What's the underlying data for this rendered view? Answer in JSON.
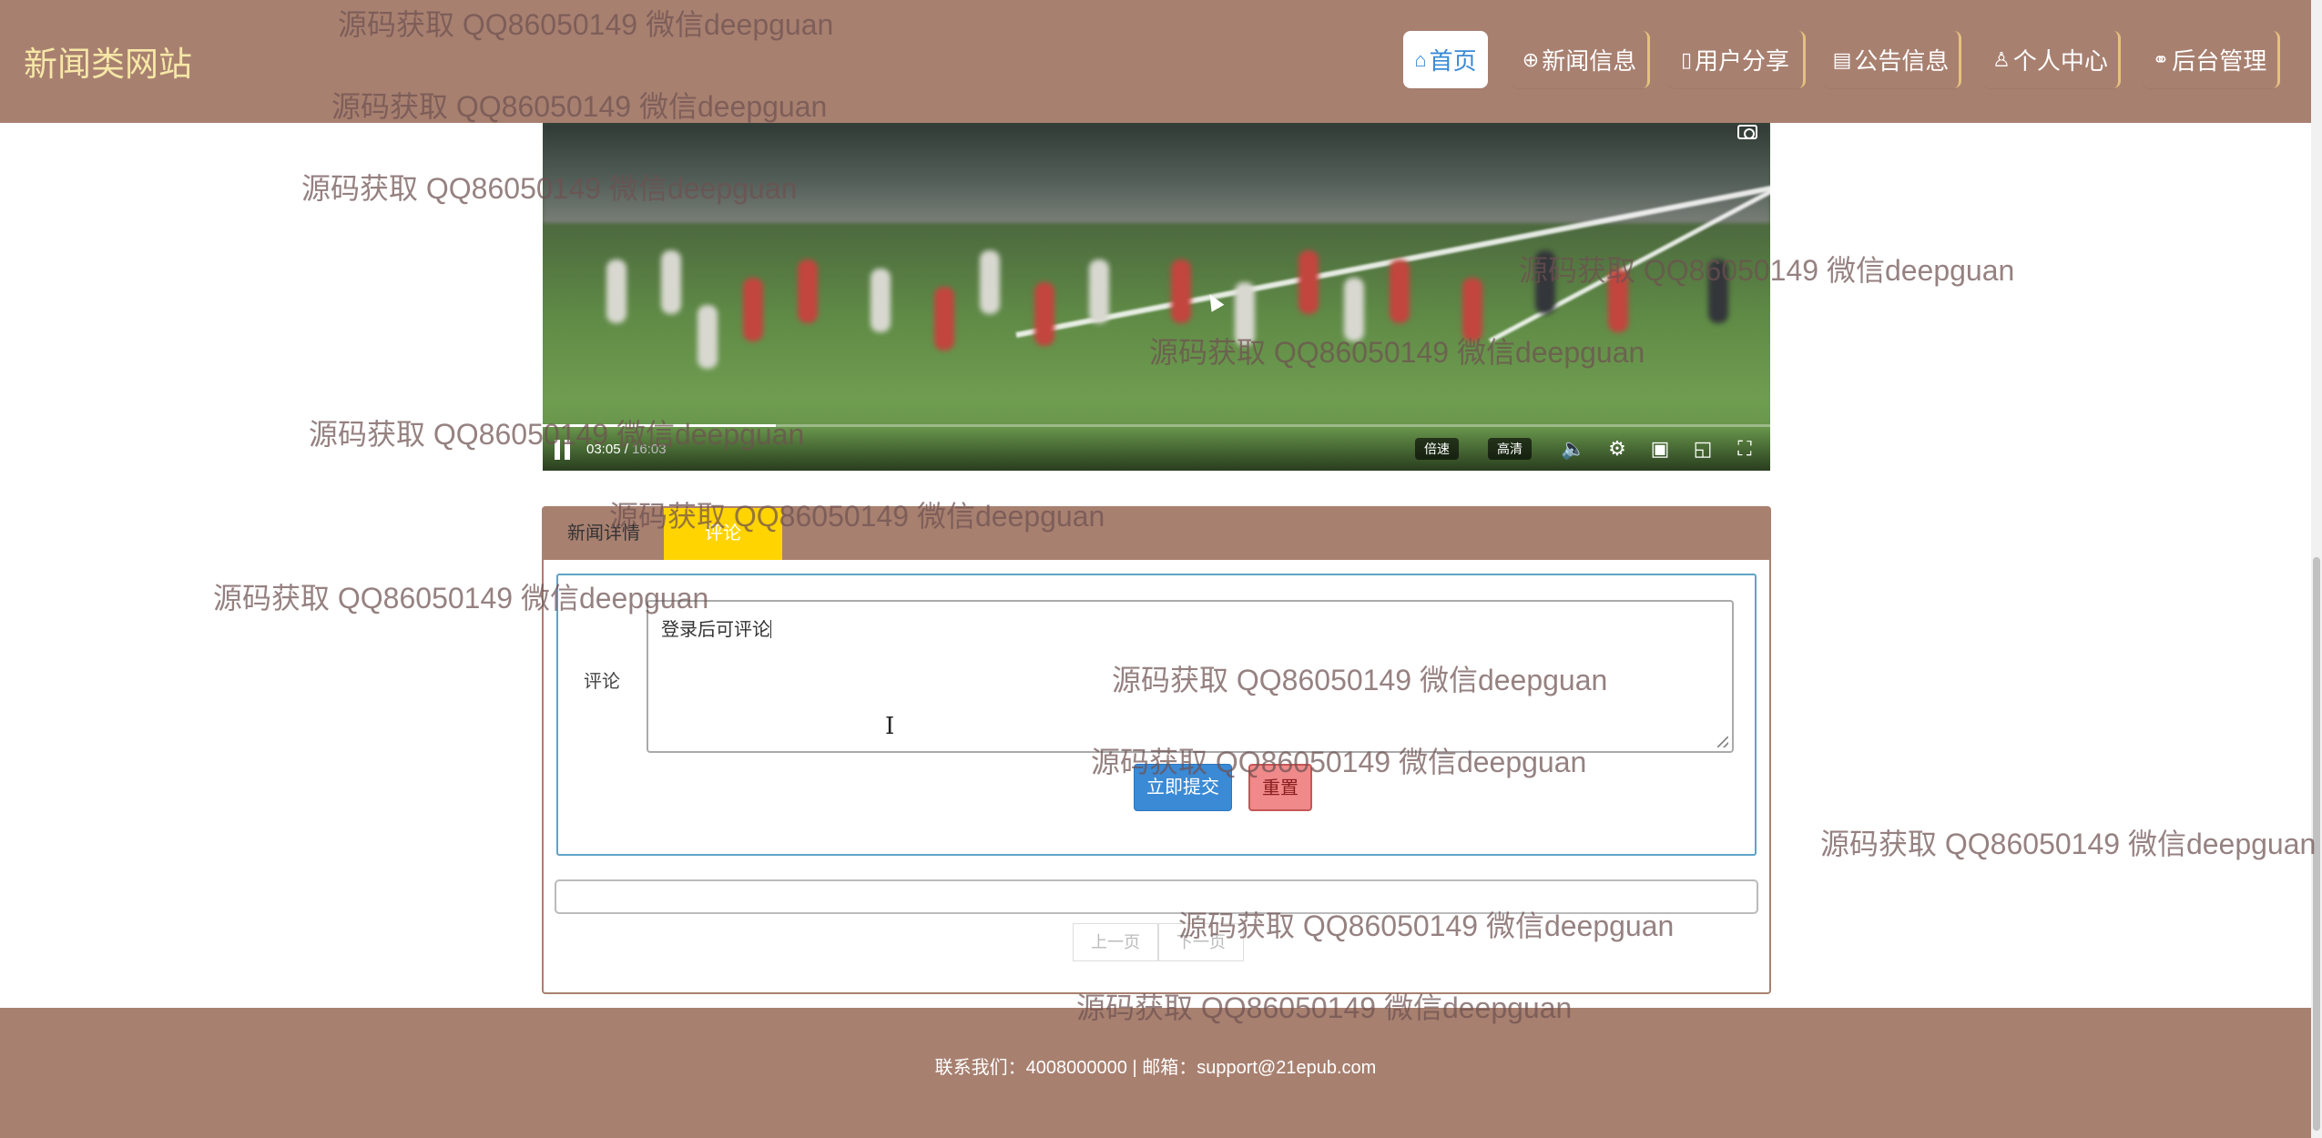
{
  "header": {
    "brand": "新闻类网站",
    "nav": [
      {
        "icon": "home-icon",
        "glyph": "⌂",
        "label": "首页",
        "active": true
      },
      {
        "icon": "globe-icon",
        "glyph": "⊕",
        "label": "新闻信息",
        "active": false
      },
      {
        "icon": "share-icon",
        "glyph": "▯",
        "label": "用户分享",
        "active": false
      },
      {
        "icon": "clipboard-icon",
        "glyph": "▤",
        "label": "公告信息",
        "active": false
      },
      {
        "icon": "user-icon",
        "glyph": "♙",
        "label": "个人中心",
        "active": false
      },
      {
        "icon": "link-icon",
        "glyph": "⚭",
        "label": "后台管理",
        "active": false
      }
    ]
  },
  "video": {
    "current_time": "03:05 /",
    "duration": "16:03",
    "progress_fraction": 0.19,
    "speed_label": "倍速",
    "quality_label": "高清"
  },
  "tabs": [
    {
      "label": "新闻详情",
      "active": false
    },
    {
      "label": "评论",
      "active": true
    }
  ],
  "comment_form": {
    "label": "评论",
    "value": "登录后可评论",
    "submit_label": "立即提交",
    "reset_label": "重置"
  },
  "pagination": {
    "prev_label": "上一页",
    "next_label": "下一页"
  },
  "footer": {
    "text": "联系我们：4008000000 | 邮箱：support@21epub.com"
  },
  "watermark": {
    "text": "源码获取 QQ86050149 微信deepguan"
  }
}
